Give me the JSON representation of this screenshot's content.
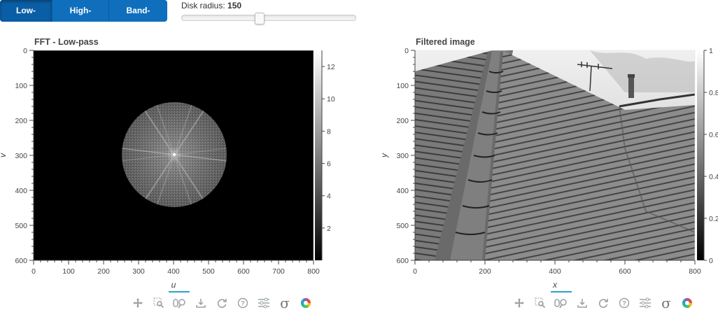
{
  "controls": {
    "filter_buttons": [
      {
        "label": "Low-pass",
        "active": true
      },
      {
        "label": "High-pass",
        "active": false
      },
      {
        "label": "Band-pass",
        "active": false
      }
    ],
    "slider": {
      "label": "Disk radius:",
      "value": "150",
      "min": 0,
      "max": 400,
      "value_num": 150
    }
  },
  "plots": [
    {
      "title": "FFT - Low-pass",
      "xlabel": "u",
      "ylabel": "v",
      "x_ticks": [
        "0",
        "100",
        "200",
        "300",
        "400",
        "500",
        "600",
        "700",
        "800"
      ],
      "y_ticks": [
        "0",
        "100",
        "200",
        "300",
        "400",
        "500",
        "600"
      ],
      "colorbar_ticks": [
        "12",
        "10",
        "8",
        "6",
        "4",
        "2"
      ]
    },
    {
      "title": "Filtered image",
      "xlabel": "x",
      "ylabel": "y",
      "x_ticks": [
        "0",
        "200",
        "400",
        "600",
        "800"
      ],
      "y_ticks": [
        "0",
        "100",
        "200",
        "300",
        "400",
        "500",
        "600"
      ],
      "colorbar_ticks": [
        "1",
        "0.8",
        "0.6",
        "0.4",
        "0.2",
        "0"
      ]
    }
  ],
  "toolbar_icons": [
    "pan-icon",
    "box-zoom-icon",
    "wheel-zoom-icon",
    "save-icon",
    "reset-icon",
    "help-icon",
    "settings-icon",
    "sigma-icon",
    "bokeh-logo-icon"
  ],
  "colors": {
    "button": "#0f6fbd",
    "button_active": "#0a5ea5",
    "accent_underline": "#26a6c9"
  }
}
